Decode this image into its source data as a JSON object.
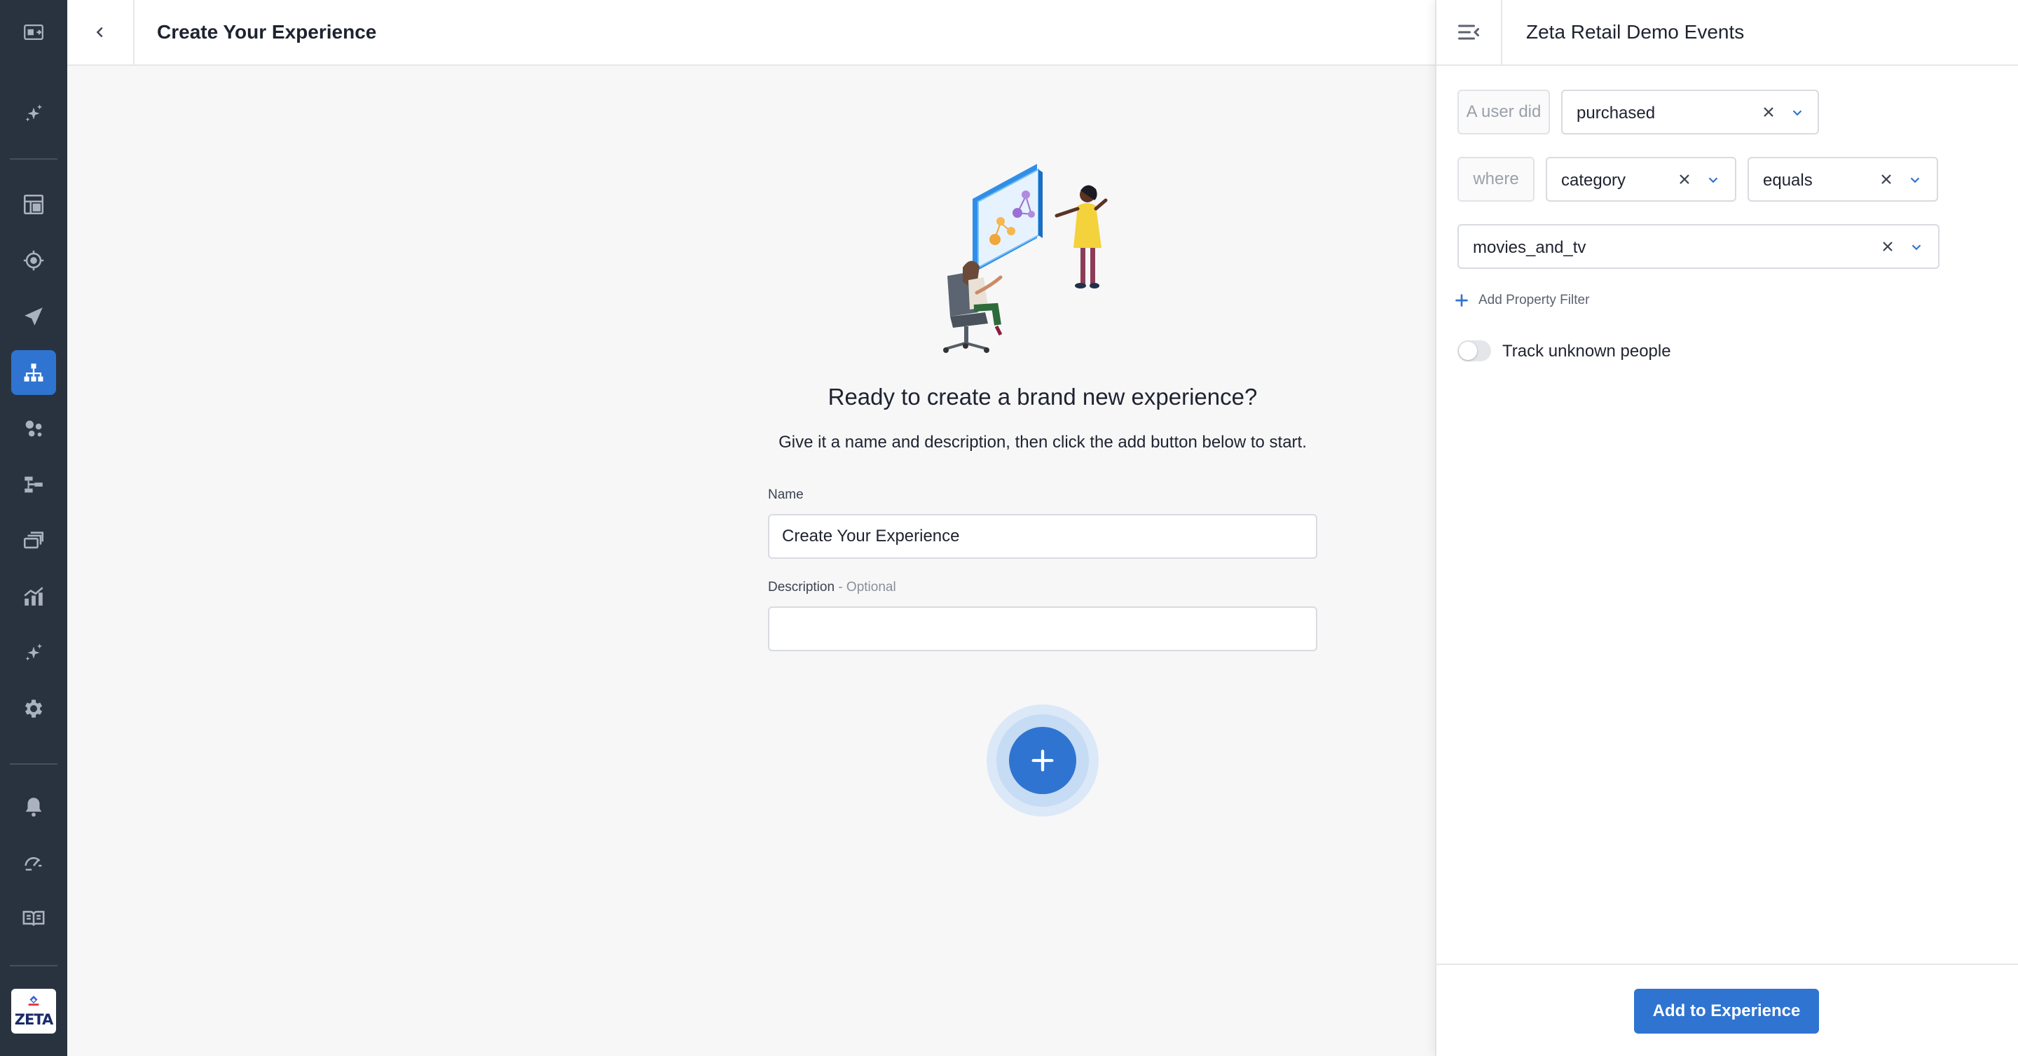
{
  "colors": {
    "sidebar_bg": "#293340",
    "accent": "#2f74d0",
    "page_bg": "#f7f7f8"
  },
  "sidebar": {
    "items": [
      {
        "icon": "switch-view-icon",
        "active": false
      },
      {
        "icon": "sparkle-icon",
        "active": false
      },
      {
        "icon": "dashboard-icon",
        "active": false
      },
      {
        "icon": "target-icon",
        "active": false
      },
      {
        "icon": "send-icon",
        "active": false
      },
      {
        "icon": "hierarchy-icon",
        "active": true
      },
      {
        "icon": "audience-icon",
        "active": false
      },
      {
        "icon": "flow-icon",
        "active": false
      },
      {
        "icon": "layers-icon",
        "active": false
      },
      {
        "icon": "analytics-icon",
        "active": false
      },
      {
        "icon": "sparkle-icon",
        "active": false
      },
      {
        "icon": "gear-icon",
        "active": false
      },
      {
        "icon": "bell-icon",
        "active": false
      },
      {
        "icon": "speed-icon",
        "active": false
      },
      {
        "icon": "book-icon",
        "active": false
      }
    ],
    "logo_text": "ZETA"
  },
  "header": {
    "title": "Create Your Experience"
  },
  "main": {
    "headline": "Ready to create a brand new experience?",
    "subline": "Give it a name and description, then click the add button below to start.",
    "name_label": "Name",
    "name_value": "Create Your Experience",
    "description_label": "Description",
    "description_optional": " - Optional",
    "description_value": ""
  },
  "panel": {
    "title": "Zeta Retail Demo Events",
    "user_did_label": "A user did",
    "event_value": "purchased",
    "where_label": "where",
    "property_value": "category",
    "operator_value": "equals",
    "filter_value": "movies_and_tv",
    "add_filter_label": "Add Property Filter",
    "track_label": "Track unknown people",
    "track_enabled": false,
    "submit_label": "Add to Experience"
  }
}
